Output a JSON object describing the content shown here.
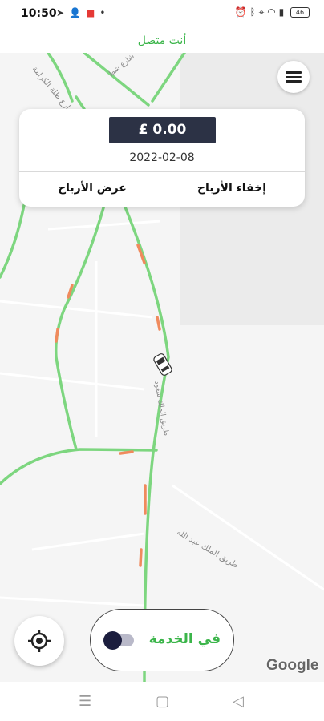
{
  "status_bar": {
    "time": "10:50",
    "left_icons": [
      "telegram-icon",
      "person-add-icon",
      "screen-record-icon",
      "dot-icon"
    ],
    "right_icons": [
      "alarm-icon",
      "bluetooth-icon",
      "location-icon",
      "wifi-icon",
      "signal-icon"
    ],
    "battery": "46"
  },
  "connection": {
    "status_text": "أنت متصل"
  },
  "earnings": {
    "amount": "£ 0.00",
    "date": "2022-02-08",
    "hide_label": "إخفاء الأرباح",
    "show_label": "عرض الأرباح"
  },
  "service": {
    "label": "في الخدمة",
    "enabled": false
  },
  "map": {
    "google_logo": "Google",
    "street_labels": [
      "شارع طلة الكرامة",
      "شارع شط",
      "طريق الملك عبد الله",
      "طريق الملك سعود"
    ]
  },
  "colors": {
    "accent_green": "#3bb54a",
    "amount_box": "#2c3245",
    "road_traffic": "#7dd67f",
    "road_slow": "#f08a5d"
  }
}
